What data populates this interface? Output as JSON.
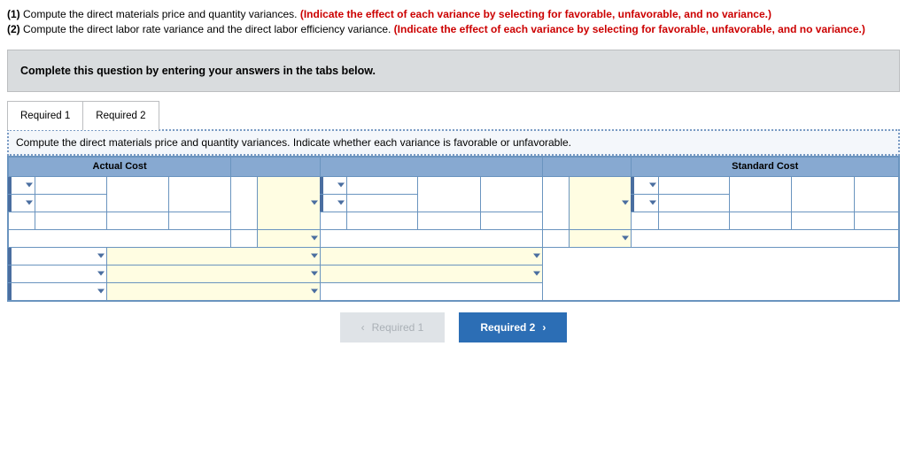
{
  "instructions": {
    "line1_num": "(1) ",
    "line1_black": "Compute the direct materials price and quantity variances. ",
    "line1_red": "(Indicate the effect of each variance by selecting for favorable, unfavorable, and no variance.)",
    "line2_num": "(2) ",
    "line2_black": "Compute the direct labor rate variance and the direct labor efficiency variance. ",
    "line2_red": "(Indicate the effect of each variance by selecting for favorable, unfavorable, and no variance.)"
  },
  "banner": "Complete this question by entering your answers in the tabs below.",
  "tabs": {
    "tab1": "Required 1",
    "tab2": "Required 2"
  },
  "prompt": "Compute the direct materials price and quantity variances. Indicate whether each variance is favorable or unfavorable.",
  "headers": {
    "actual_cost": "Actual Cost",
    "standard_cost": "Standard Cost"
  },
  "nav": {
    "prev": "Required 1",
    "next": "Required 2"
  }
}
